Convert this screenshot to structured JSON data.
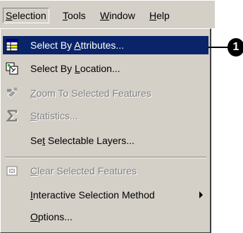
{
  "menubar": {
    "items": [
      {
        "mnemonic": "S",
        "rest": "election"
      },
      {
        "mnemonic": "T",
        "rest": "ools"
      },
      {
        "mnemonic": "W",
        "rest": "indow"
      },
      {
        "mnemonic": "H",
        "rest": "elp"
      }
    ]
  },
  "menu": {
    "items": [
      {
        "pre": "Select By ",
        "mnemonic": "A",
        "post": "ttributes...",
        "icon": "select-by-attributes-icon",
        "state": "highlighted"
      },
      {
        "pre": "Select By ",
        "mnemonic": "L",
        "post": "ocation...",
        "icon": "select-by-location-icon",
        "state": "enabled"
      },
      {
        "pre": "",
        "mnemonic": "Z",
        "post": "oom To Selected Features",
        "icon": "zoom-to-selected-icon",
        "state": "disabled"
      },
      {
        "pre": "",
        "mnemonic": "S",
        "post": "tatistics...",
        "icon": "statistics-sigma-icon",
        "state": "disabled"
      },
      {
        "pre": "Se",
        "mnemonic": "t",
        "post": " Selectable Layers...",
        "icon": "",
        "state": "enabled"
      },
      {
        "pre": "",
        "mnemonic": "C",
        "post": "lear Selected Features",
        "icon": "clear-selection-icon",
        "state": "disabled"
      },
      {
        "pre": "",
        "mnemonic": "I",
        "post": "nteractive Selection Method",
        "icon": "",
        "state": "enabled",
        "submenu": true
      },
      {
        "pre": "",
        "mnemonic": "O",
        "post": "ptions...",
        "icon": "",
        "state": "enabled"
      }
    ]
  },
  "callout": {
    "number": "1"
  },
  "colors": {
    "highlight": "#0a246a",
    "menu_bg": "#d4d0c8",
    "disabled_text": "#808080"
  }
}
